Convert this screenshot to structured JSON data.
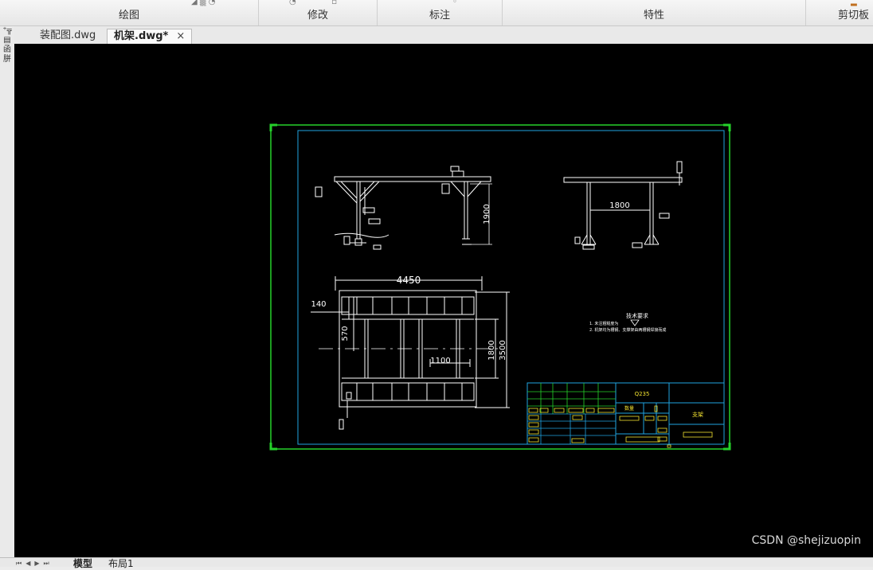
{
  "ribbon": {
    "groups": [
      "绘图",
      "修改",
      "标注",
      "特性",
      "剪切板"
    ]
  },
  "leftbar": {
    "glyphs": [
      "⁺╦",
      "▤",
      "函",
      "胼"
    ]
  },
  "doc_tabs": [
    {
      "label": "装配图.dwg",
      "active": false
    },
    {
      "label": "机架.dwg*",
      "active": true
    }
  ],
  "close_glyph": "×",
  "drawing": {
    "dims": {
      "front_height": "1900",
      "side_width": "1800",
      "plan_length": "4450",
      "plan_140": "140",
      "plan_570": "570",
      "plan_1100": "1100",
      "plan_1800": "1800",
      "plan_3500": "3500"
    },
    "notes": {
      "title": "技术要求",
      "line1": "1. 未注粗糙度为",
      "line2": "2. 机架均为槽钢、支撑架由两槽钢焊接而成"
    },
    "title_block": {
      "material": "Q235",
      "qty_label": "数量",
      "part_name": "支架"
    }
  },
  "layout_tabs": [
    "模型",
    "布局1"
  ],
  "nav_glyphs": "⏮◀▶⏭",
  "watermark": "CSDN @shejizuopin"
}
